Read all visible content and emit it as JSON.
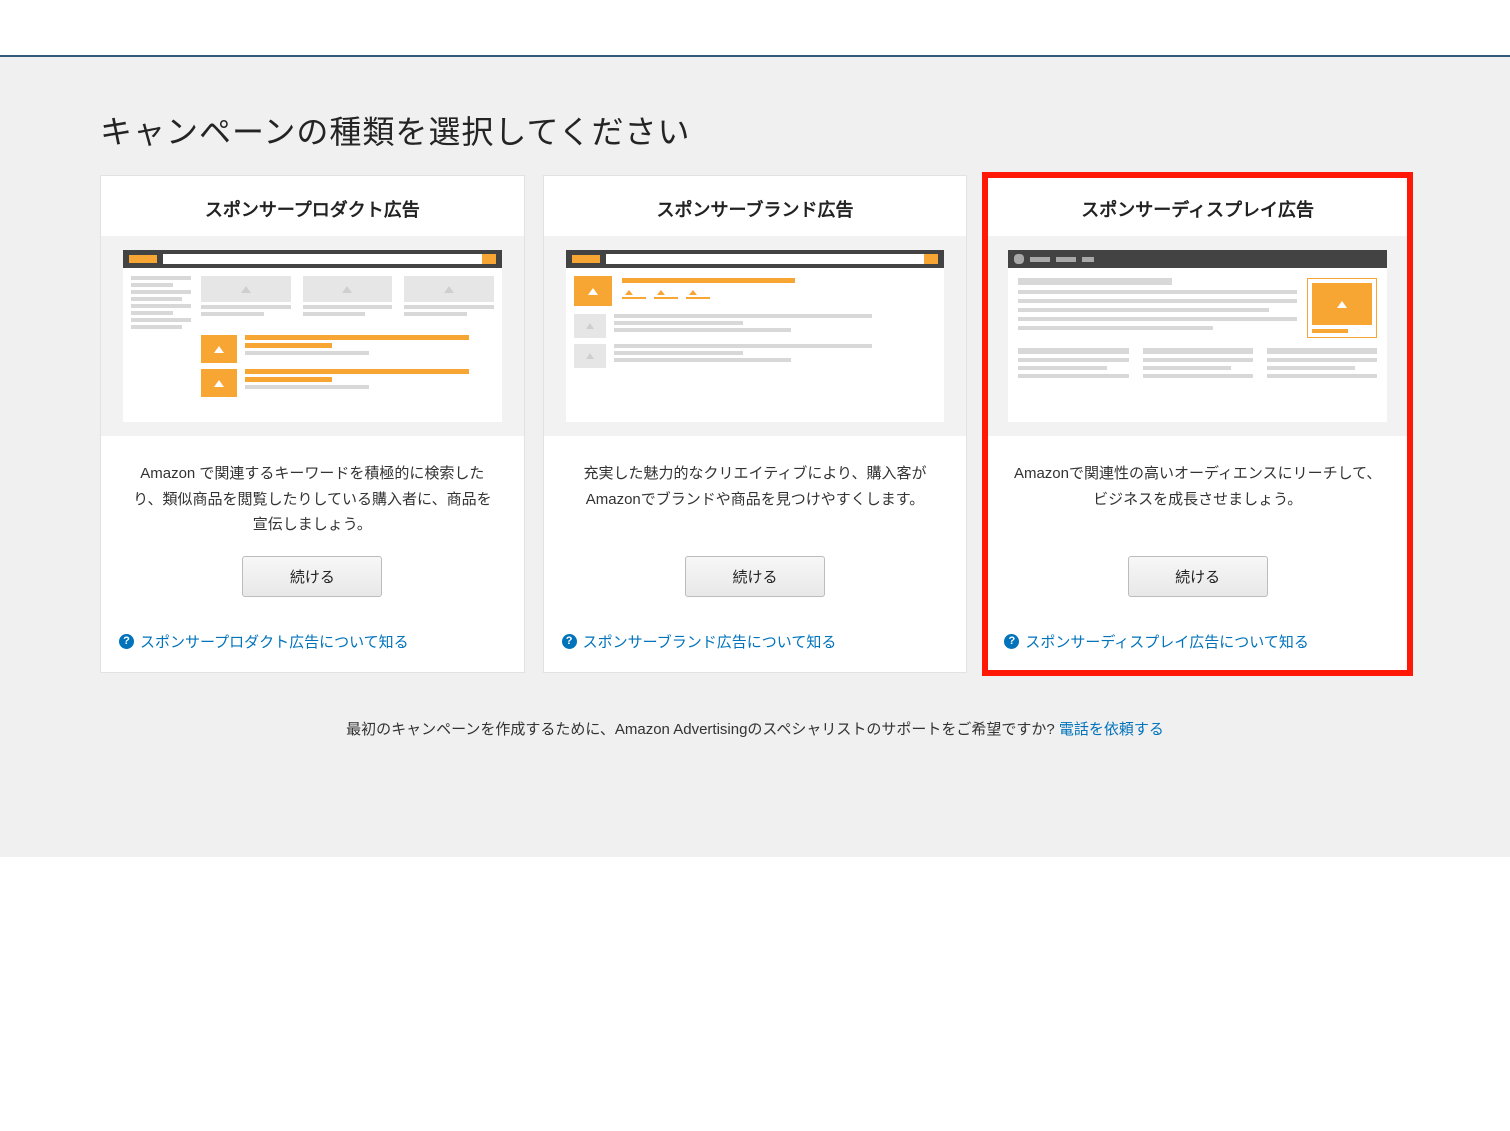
{
  "page": {
    "title": "キャンペーンの種類を選択してください"
  },
  "cards": [
    {
      "title": "スポンサープロダクト広告",
      "description": "Amazon で関連するキーワードを積極的に検索したり、類似商品を閲覧したりしている購入者に、商品を宣伝しましょう。",
      "button": "続ける",
      "learn_more": "スポンサープロダクト広告について知る",
      "highlighted": false
    },
    {
      "title": "スポンサーブランド広告",
      "description": "充実した魅力的なクリエイティブにより、購入客がAmazonでブランドや商品を見つけやすくします。",
      "button": "続ける",
      "learn_more": "スポンサーブランド広告について知る",
      "highlighted": false
    },
    {
      "title": "スポンサーディスプレイ広告",
      "description": "Amazonで関連性の高いオーディエンスにリーチして、ビジネスを成長させましょう。",
      "button": "続ける",
      "learn_more": "スポンサーディスプレイ広告について知る",
      "highlighted": true
    }
  ],
  "footer": {
    "text": "最初のキャンペーンを作成するために、Amazon Advertisingのスペシャリストのサポートをご希望ですか? ",
    "link": "電話を依頼する"
  },
  "colors": {
    "accent_orange": "#f7a633",
    "link_blue": "#0073bb",
    "highlight_red": "#ff1806"
  }
}
